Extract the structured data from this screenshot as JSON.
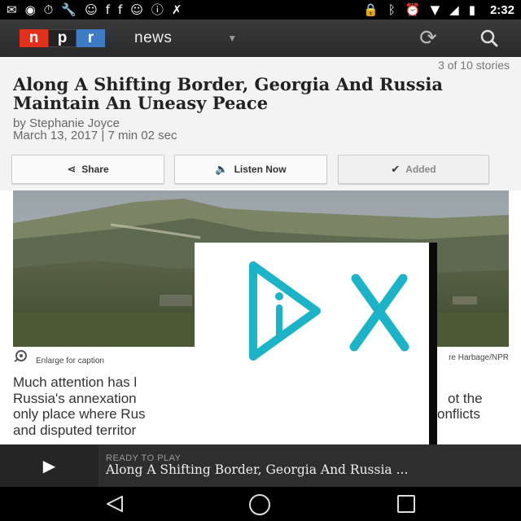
{
  "status_bar": {
    "time": "2:32",
    "icons_left": [
      "mail-icon",
      "record-icon",
      "alarm-icon",
      "wrench-icon",
      "smiley-icon",
      "facebook-icon",
      "facebook-icon",
      "smiley-icon",
      "info-icon",
      "no-signal-icon"
    ],
    "icons_right": [
      "lock-icon",
      "bluetooth-icon",
      "alarm-icon",
      "wifi-icon",
      "signal-icon",
      "battery-charging-icon"
    ]
  },
  "app_bar": {
    "logo": [
      "n",
      "p",
      "r"
    ],
    "section": "news"
  },
  "article": {
    "story_count": "3 of 10 stories",
    "headline": "Along A Shifting Border, Georgia And Russia Maintain An Uneasy Peace",
    "byline": "by Stephanie Joyce",
    "dateline": "March 13, 2017 | 7 min 02 sec",
    "caption": "Enlarge for caption",
    "credit": "re Harbage/NPR",
    "body": "Much attention has l... Russia's annexation ... ot the only place where Rus... onflicts and disputed territor...",
    "body_lines": [
      "Much attention has l",
      "Russia's annexation",
      "only place where Rus",
      "and disputed territor"
    ],
    "body_lines_right": [
      "",
      "ot the",
      "onflicts",
      ""
    ]
  },
  "actions": {
    "share": "Share",
    "listen": "Listen Now",
    "added": "Added"
  },
  "player": {
    "ready_label": "READY TO PLAY",
    "title": "Along A Shifting Border, Georgia And Russia ..."
  },
  "colors": {
    "npr_red": "#e1311c",
    "npr_blue": "#3e7bc6",
    "ad_cyan": "#1ab3c8"
  }
}
